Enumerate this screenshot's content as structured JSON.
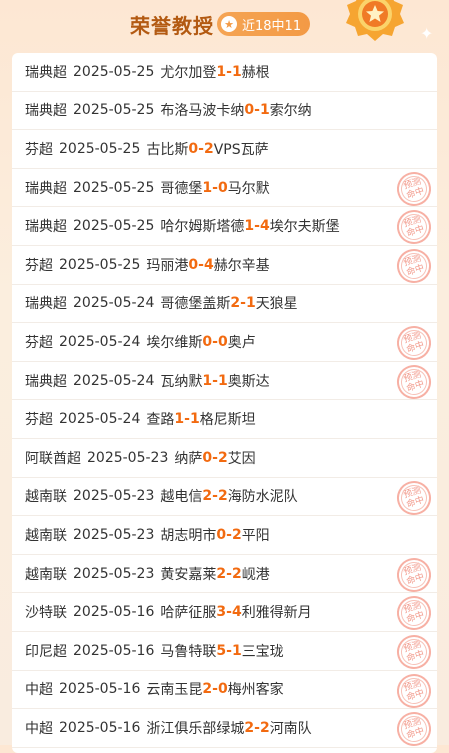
{
  "header": {
    "title": "荣誉教授",
    "badge_text": "近18中11",
    "accent_color": "#f39a45"
  },
  "stamp_text": "预测\n命中",
  "matches": [
    {
      "league": "瑞典超",
      "date": "2025-05-25",
      "home": "尤尔加登",
      "home_score": "1",
      "away_score": "1",
      "away": "赫根",
      "hit": false
    },
    {
      "league": "瑞典超",
      "date": "2025-05-25",
      "home": "布洛马波卡纳",
      "home_score": "0",
      "away_score": "1",
      "away": "索尔纳",
      "hit": false
    },
    {
      "league": "芬超",
      "date": "2025-05-25",
      "home": "古比斯",
      "home_score": "0",
      "away_score": "2",
      "away": "VPS瓦萨",
      "hit": false
    },
    {
      "league": "瑞典超",
      "date": "2025-05-25",
      "home": "哥德堡",
      "home_score": "1",
      "away_score": "0",
      "away": "马尔默",
      "hit": true
    },
    {
      "league": "瑞典超",
      "date": "2025-05-25",
      "home": "哈尔姆斯塔德",
      "home_score": "1",
      "away_score": "4",
      "away": "埃尔夫斯堡",
      "hit": true
    },
    {
      "league": "芬超",
      "date": "2025-05-25",
      "home": "玛丽港",
      "home_score": "0",
      "away_score": "4",
      "away": "赫尔辛基",
      "hit": true
    },
    {
      "league": "瑞典超",
      "date": "2025-05-24",
      "home": "哥德堡盖斯",
      "home_score": "2",
      "away_score": "1",
      "away": "天狼星",
      "hit": false
    },
    {
      "league": "芬超",
      "date": "2025-05-24",
      "home": "埃尔维斯",
      "home_score": "0",
      "away_score": "0",
      "away": "奥卢",
      "hit": true
    },
    {
      "league": "瑞典超",
      "date": "2025-05-24",
      "home": "瓦纳默",
      "home_score": "1",
      "away_score": "1",
      "away": "奥斯达",
      "hit": true
    },
    {
      "league": "芬超",
      "date": "2025-05-24",
      "home": "查路",
      "home_score": "1",
      "away_score": "1",
      "away": "格尼斯坦",
      "hit": false
    },
    {
      "league": "阿联酋超",
      "date": "2025-05-23",
      "home": "纳萨",
      "home_score": "0",
      "away_score": "2",
      "away": "艾因",
      "hit": false
    },
    {
      "league": "越南联",
      "date": "2025-05-23",
      "home": "越电信",
      "home_score": "2",
      "away_score": "2",
      "away": "海防水泥队",
      "hit": true
    },
    {
      "league": "越南联",
      "date": "2025-05-23",
      "home": "胡志明市",
      "home_score": "0",
      "away_score": "2",
      "away": "平阳",
      "hit": false
    },
    {
      "league": "越南联",
      "date": "2025-05-23",
      "home": "黄安嘉莱",
      "home_score": "2",
      "away_score": "2",
      "away": "岘港",
      "hit": true
    },
    {
      "league": "沙特联",
      "date": "2025-05-16",
      "home": "哈萨征服",
      "home_score": "3",
      "away_score": "4",
      "away": "利雅得新月",
      "hit": true
    },
    {
      "league": "印尼超",
      "date": "2025-05-16",
      "home": "马鲁特联",
      "home_score": "5",
      "away_score": "1",
      "away": "三宝珑",
      "hit": true
    },
    {
      "league": "中超",
      "date": "2025-05-16",
      "home": "云南玉昆",
      "home_score": "2",
      "away_score": "0",
      "away": "梅州客家",
      "hit": true
    },
    {
      "league": "中超",
      "date": "2025-05-16",
      "home": "浙江俱乐部绿城",
      "home_score": "2",
      "away_score": "2",
      "away": "河南队",
      "hit": true
    }
  ]
}
